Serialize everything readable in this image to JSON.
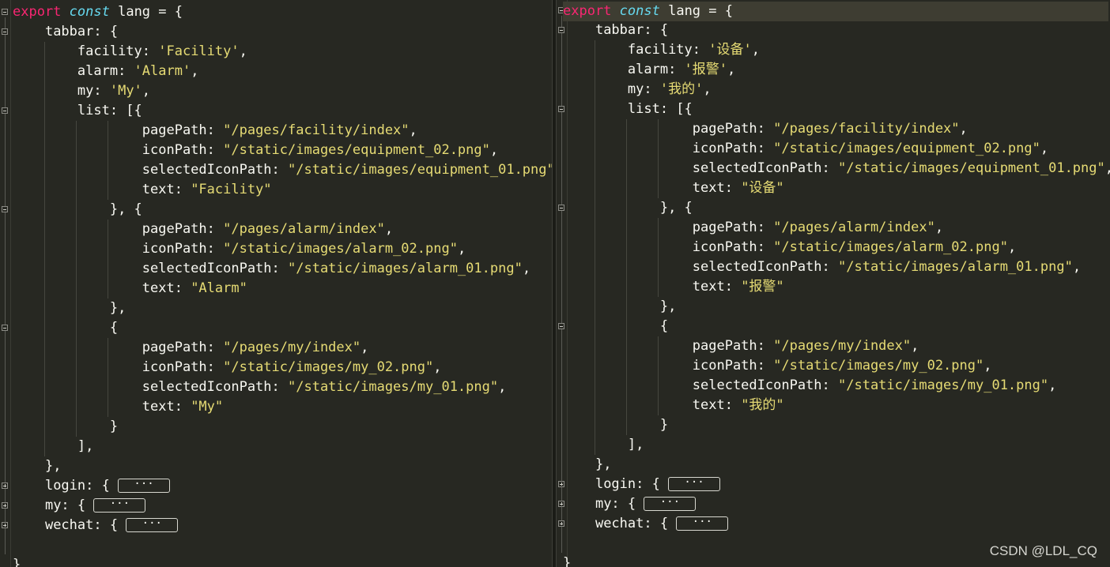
{
  "window": {
    "watermark": "CSDN @LDL_CQ"
  },
  "code": {
    "export_kw": "export",
    "const_kw": "const",
    "decl_rest": " lang = {",
    "tabbar_line": "tabbar: {",
    "facility_key": "facility: ",
    "alarm_key": "alarm: ",
    "my_key": "my: ",
    "list_open": "list: [{",
    "pagePath_key": "pagePath: ",
    "iconPath_key": "iconPath: ",
    "selectedIconPath_key": "selectedIconPath: ",
    "text_key": "text: ",
    "comma": ",",
    "close_open": "}, {",
    "close_comma": "},",
    "open_brace": "{",
    "close_brace": "}",
    "bracket_close": "],",
    "login_key": "login: { ",
    "my_obj_key": "my: { ",
    "wechat_key": "wechat: { ",
    "fold_placeholder": "···",
    "final_brace": "}",
    "facility_path": "\"/pages/facility/index\"",
    "facility_icon": "\"/static/images/equipment_02.png\"",
    "facility_selected": "\"/static/images/equipment_01.png\"",
    "alarm_path": "\"/pages/alarm/index\"",
    "alarm_icon": "\"/static/images/alarm_02.png\"",
    "alarm_selected": "\"/static/images/alarm_01.png\"",
    "my_path": "\"/pages/my/index\"",
    "my_icon": "\"/static/images/my_02.png\"",
    "my_selected": "\"/static/images/my_01.png\""
  },
  "left": {
    "facility_val": "'Facility'",
    "alarm_val": "'Alarm'",
    "my_val": "'My'",
    "facility_text": "\"Facility\"",
    "alarm_text": "\"Alarm\"",
    "my_text": "\"My\""
  },
  "right": {
    "facility_val": "'设备'",
    "alarm_val": "'报警'",
    "my_val": "'我的'",
    "facility_text": "\"设备\"",
    "alarm_text": "\"报警\"",
    "my_text": "\"我的\""
  },
  "colors": {
    "background": "#272822",
    "keyword": "#f92672",
    "storage": "#66d9ef",
    "string": "#e6db74",
    "plain": "#f8f8f2"
  }
}
